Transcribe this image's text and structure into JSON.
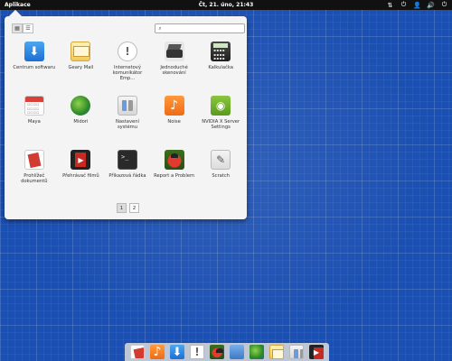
{
  "panel": {
    "apps_label": "Aplikace",
    "clock": "Čt, 21. úno, 21:43",
    "tray": [
      {
        "icon": "sort-icon",
        "glyph": "⇅"
      },
      {
        "icon": "power-icon",
        "glyph": "⏻"
      },
      {
        "icon": "user-icon",
        "glyph": "👤"
      },
      {
        "icon": "volume-icon",
        "glyph": "🔊"
      },
      {
        "icon": "settings-icon",
        "glyph": "⏻"
      }
    ]
  },
  "launcher": {
    "search": {
      "placeholder": ""
    },
    "apps": [
      {
        "label": "Centrum softwaru",
        "icon": "center"
      },
      {
        "label": "Geary Mail",
        "icon": "geary"
      },
      {
        "label": "Internetový komunikátor Emp...",
        "icon": "chat"
      },
      {
        "label": "Jednoduché skenování",
        "icon": "scan"
      },
      {
        "label": "Kalkulačka",
        "icon": "calc"
      },
      {
        "label": "Maya",
        "icon": "maya"
      },
      {
        "label": "Midori",
        "icon": "midori"
      },
      {
        "label": "Nastavení systému",
        "icon": "settings"
      },
      {
        "label": "Noise",
        "icon": "noise"
      },
      {
        "label": "NVIDIA X Server Settings",
        "icon": "nvidia"
      },
      {
        "label": "Prohlížeč dokumentů",
        "icon": "docs"
      },
      {
        "label": "Přehrávač filmů",
        "icon": "video"
      },
      {
        "label": "Příkazová řádka",
        "icon": "term"
      },
      {
        "label": "Report a Problem",
        "icon": "bug"
      },
      {
        "label": "Scratch",
        "icon": "scratch"
      }
    ],
    "pages": [
      "1",
      "2"
    ],
    "current_page": "1"
  },
  "dock": [
    {
      "icon": "docs"
    },
    {
      "icon": "noise"
    },
    {
      "icon": "center"
    },
    {
      "icon": "chat"
    },
    {
      "icon": "bug"
    },
    {
      "icon": "folder"
    },
    {
      "icon": "midori"
    },
    {
      "icon": "geary"
    },
    {
      "icon": "settings"
    },
    {
      "icon": "video"
    }
  ]
}
